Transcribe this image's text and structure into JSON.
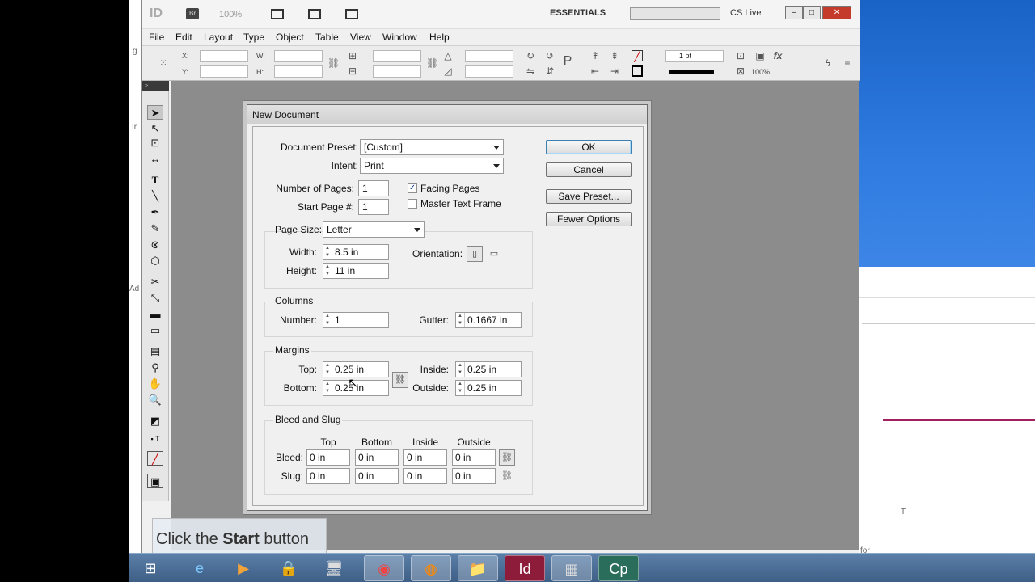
{
  "app": {
    "logo": "ID",
    "bridge": "Br",
    "zoom": "100%",
    "workspace": "ESSENTIALS",
    "cslive": "CS Live"
  },
  "menu": [
    "File",
    "Edit",
    "Layout",
    "Type",
    "Object",
    "Table",
    "View",
    "Window",
    "Help"
  ],
  "control": {
    "x_label": "X:",
    "y_label": "Y:",
    "w_label": "W:",
    "h_label": "H:",
    "stroke_weight": "1 pt",
    "opacity": "100%"
  },
  "dialog": {
    "title": "New Document",
    "preset_label": "Document Preset:",
    "preset_value": "[Custom]",
    "intent_label": "Intent:",
    "intent_value": "Print",
    "pages_label": "Number of Pages:",
    "pages_value": "1",
    "start_label": "Start Page #:",
    "start_value": "1",
    "facing_label": "Facing Pages",
    "facing_checked": true,
    "master_label": "Master Text Frame",
    "master_checked": false,
    "page_size_label": "Page Size:",
    "page_size_value": "Letter",
    "width_label": "Width:",
    "width_value": "8.5 in",
    "height_label": "Height:",
    "height_value": "11 in",
    "orientation_label": "Orientation:",
    "columns_title": "Columns",
    "number_label": "Number:",
    "number_value": "1",
    "gutter_label": "Gutter:",
    "gutter_value": "0.1667 in",
    "margins_title": "Margins",
    "top_label": "Top:",
    "top_value": "0.25 in",
    "bottom_label": "Bottom:",
    "bottom_value": "0.25 in",
    "inside_label": "Inside:",
    "inside_value": "0.25 in",
    "outside_label": "Outside:",
    "outside_value": "0.25 in",
    "bleed_title": "Bleed and Slug",
    "col_top": "Top",
    "col_bottom": "Bottom",
    "col_inside": "Inside",
    "col_outside": "Outside",
    "bleed_label": "Bleed:",
    "slug_label": "Slug:",
    "bleed_values": [
      "0 in",
      "0 in",
      "0 in",
      "0 in"
    ],
    "slug_values": [
      "0 in",
      "0 in",
      "0 in",
      "0 in"
    ],
    "ok_label": "OK",
    "cancel_label": "Cancel",
    "save_preset_label": "Save Preset...",
    "fewer_options_label": "Fewer Options"
  },
  "tooltip": {
    "prefix": "Click the ",
    "bold": "Start",
    "suffix": " button"
  }
}
